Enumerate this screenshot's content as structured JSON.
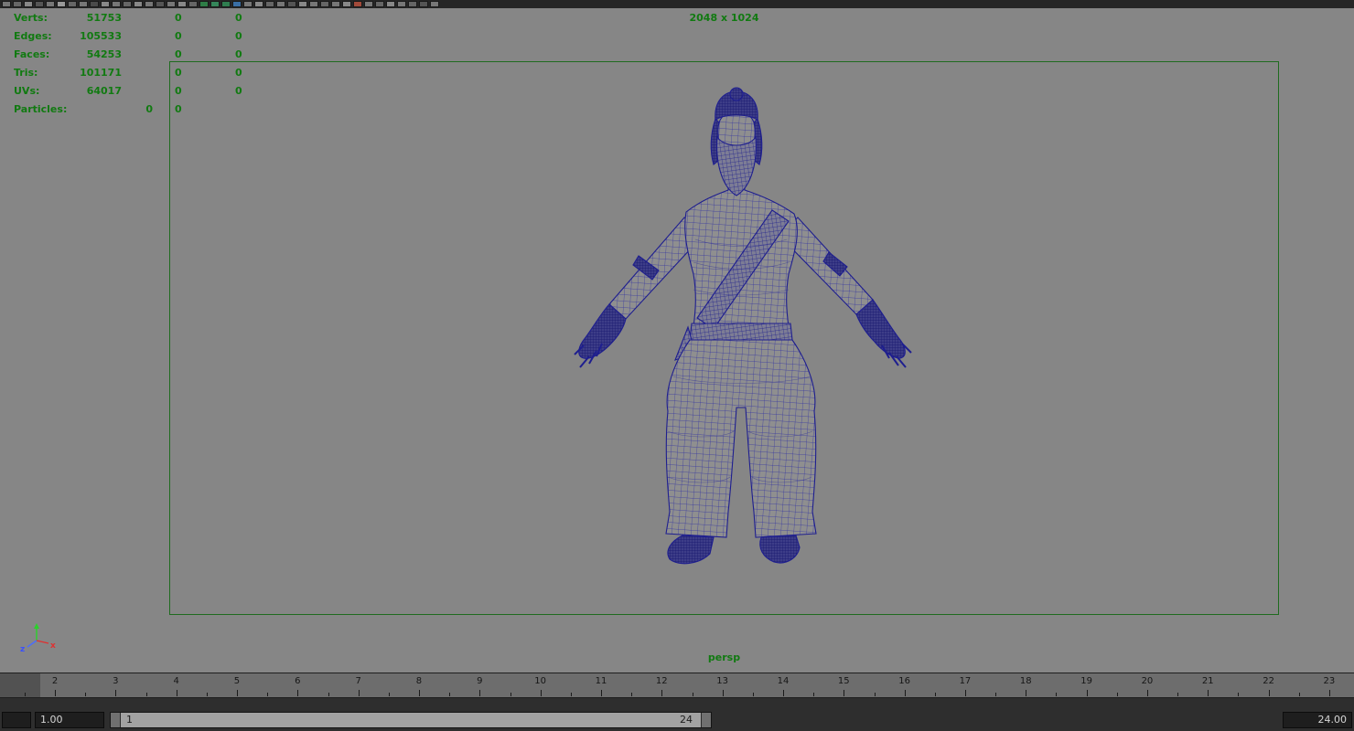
{
  "colors": {
    "hud_green": "#117a11",
    "gate_green": "#1f6b1f",
    "viewport_gray": "#868686",
    "wireframe_blue": "#1e1e8f"
  },
  "toolbar": {
    "icons": [
      "#777777",
      "#666666",
      "#888888",
      "#555555",
      "#777777",
      "#999999",
      "#666666",
      "#777777",
      "#4a4a4a",
      "#888888",
      "#777777",
      "#666666",
      "#888888",
      "#777777",
      "#555555",
      "#777777",
      "#888888",
      "#666666",
      "#2e7d46",
      "#35865a",
      "#2f7d4f",
      "#3a6ea5",
      "#777777",
      "#888888",
      "#666666",
      "#777777",
      "#555555",
      "#888888",
      "#777777",
      "#666666",
      "#777777",
      "#888888",
      "#a24a3a",
      "#777777",
      "#666666",
      "#888888",
      "#777777",
      "#666666",
      "#555555",
      "#777777"
    ]
  },
  "hud": {
    "rows": [
      {
        "label": "Verts:",
        "v1": "51753",
        "v2": "0",
        "v3": "0"
      },
      {
        "label": "Edges:",
        "v1": "105533",
        "v2": "0",
        "v3": "0"
      },
      {
        "label": "Faces:",
        "v1": "54253",
        "v2": "0",
        "v3": "0"
      },
      {
        "label": "Tris:",
        "v1": "101171",
        "v2": "0",
        "v3": "0"
      },
      {
        "label": "UVs:",
        "v1": "64017",
        "v2": "0",
        "v3": "0"
      },
      {
        "label": "Particles:",
        "v1": "0",
        "v2": "0"
      }
    ],
    "resolution_label": "2048 x 1024",
    "camera_label": "persp"
  },
  "axis": {
    "x_label": "x",
    "z_label": "z"
  },
  "timeline": {
    "frames": [
      "2",
      "3",
      "4",
      "5",
      "6",
      "7",
      "8",
      "9",
      "10",
      "11",
      "12",
      "13",
      "14",
      "15",
      "16",
      "17",
      "18",
      "19",
      "20",
      "21",
      "22",
      "23"
    ]
  },
  "range_bar": {
    "start_field": "1.00",
    "end_field": "24.00",
    "range_start": "1",
    "range_end": "24"
  }
}
